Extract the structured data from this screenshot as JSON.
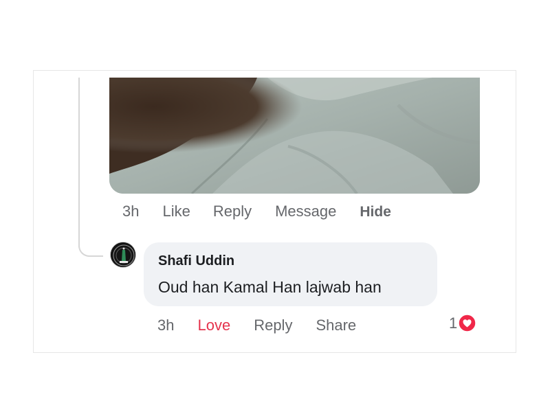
{
  "previous_comment": {
    "actions": {
      "time": "3h",
      "like": "Like",
      "reply": "Reply",
      "message": "Message",
      "hide": "Hide"
    }
  },
  "reply_comment": {
    "author": "Shafi Uddin",
    "text": "Oud han Kamal Han lajwab han",
    "actions": {
      "time": "3h",
      "love": "Love",
      "reply": "Reply",
      "share": "Share"
    },
    "reaction_count": "1",
    "reaction_icon": "love-reaction-icon"
  },
  "colors": {
    "action_gray": "#65676b",
    "love_red": "#e5334d",
    "bubble_bg": "#f0f2f5"
  }
}
